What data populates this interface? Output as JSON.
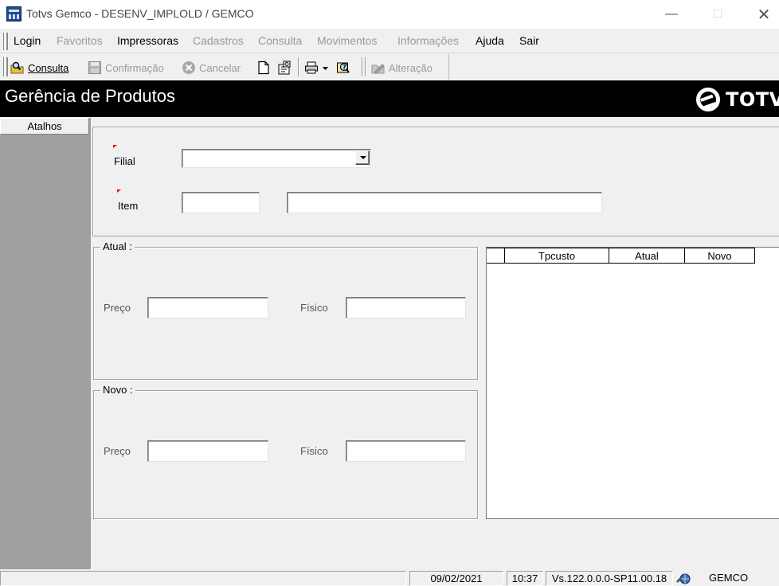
{
  "window": {
    "title": "Totvs Gemco - DESENV_IMPLOLD / GEMCO"
  },
  "menu": [
    {
      "label": "Login",
      "enabled": true
    },
    {
      "label": "Favoritos",
      "enabled": false
    },
    {
      "label": "Impressoras",
      "enabled": true
    },
    {
      "label": "Cadastros",
      "enabled": false
    },
    {
      "label": "Consulta",
      "enabled": false
    },
    {
      "label": "Movimentos",
      "enabled": false
    },
    {
      "label": "Informações",
      "enabled": false
    },
    {
      "label": "Ajuda",
      "enabled": true
    },
    {
      "label": "Sair",
      "enabled": true
    }
  ],
  "toolbar": {
    "consulta": "Consulta",
    "confirmacao": "Confirmação",
    "cancelar": "Cancelar",
    "alteracao": "Alteração"
  },
  "header": {
    "title": "Gerência de Produtos",
    "brand": "TOTVS"
  },
  "sidebar": {
    "tab": "Atalhos"
  },
  "form": {
    "filial_label": "Filial",
    "filial_value": "",
    "item_label": "Item",
    "item_code": "",
    "item_description": ""
  },
  "atual": {
    "legend": "Atual :",
    "preco_label": "Preço",
    "preco_value": "",
    "fisico_label": "Físico",
    "fisico_value": ""
  },
  "novo": {
    "legend": "Novo :",
    "preco_label": "Preço",
    "preco_value": "",
    "fisico_label": "Físico",
    "fisico_value": ""
  },
  "grid": {
    "columns": [
      "Tpcusto",
      "Atual",
      "Novo"
    ],
    "rows": []
  },
  "status": {
    "date": "09/02/2021",
    "time": "10:37",
    "version": "Vs.122.0.0.0-SP11.00.18",
    "user": "GEMCO"
  }
}
